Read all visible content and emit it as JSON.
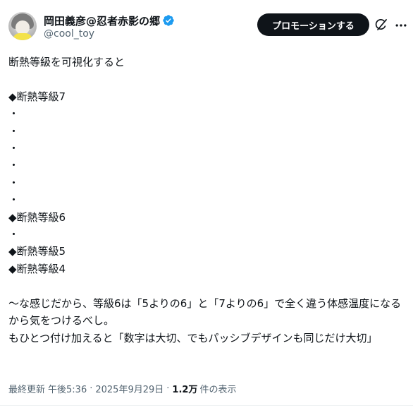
{
  "author": {
    "display_name": "岡田義彦@忍者赤影の郷",
    "handle": "@cool_toy",
    "avatar_icon": "avatar-icon",
    "verified_icon": "verified-badge-icon",
    "verified_color": "#1d9bf0"
  },
  "actions": {
    "promote_label": "プロモーションする",
    "grok_icon": "grok-icon",
    "more_icon": "more-icon"
  },
  "tweet": {
    "text": "断熱等級を可視化すると\n\n◆断熱等級7\n・\n・\n・\n・\n・\n・\n◆断熱等級6\n・\n◆断熱等級5\n◆断熱等級4\n\n〜な感じだから、等級6は「5よりの6」と「7よりの6」で全く違う体感温度になるから気をつけるべし。\nもひとつ付け加えると「数字は大切、でもパッシブデザインも同じだけ大切」"
  },
  "meta": {
    "last_updated": "最終更新",
    "time": "午後5:36",
    "date": "2025年9月29日",
    "views_count": "1.2万",
    "views_label": "件の表示",
    "separator": "·"
  },
  "colors": {
    "text_primary": "#0f1419",
    "text_secondary": "#536471",
    "button_bg": "#0f1419",
    "accent": "#1d9bf0"
  }
}
